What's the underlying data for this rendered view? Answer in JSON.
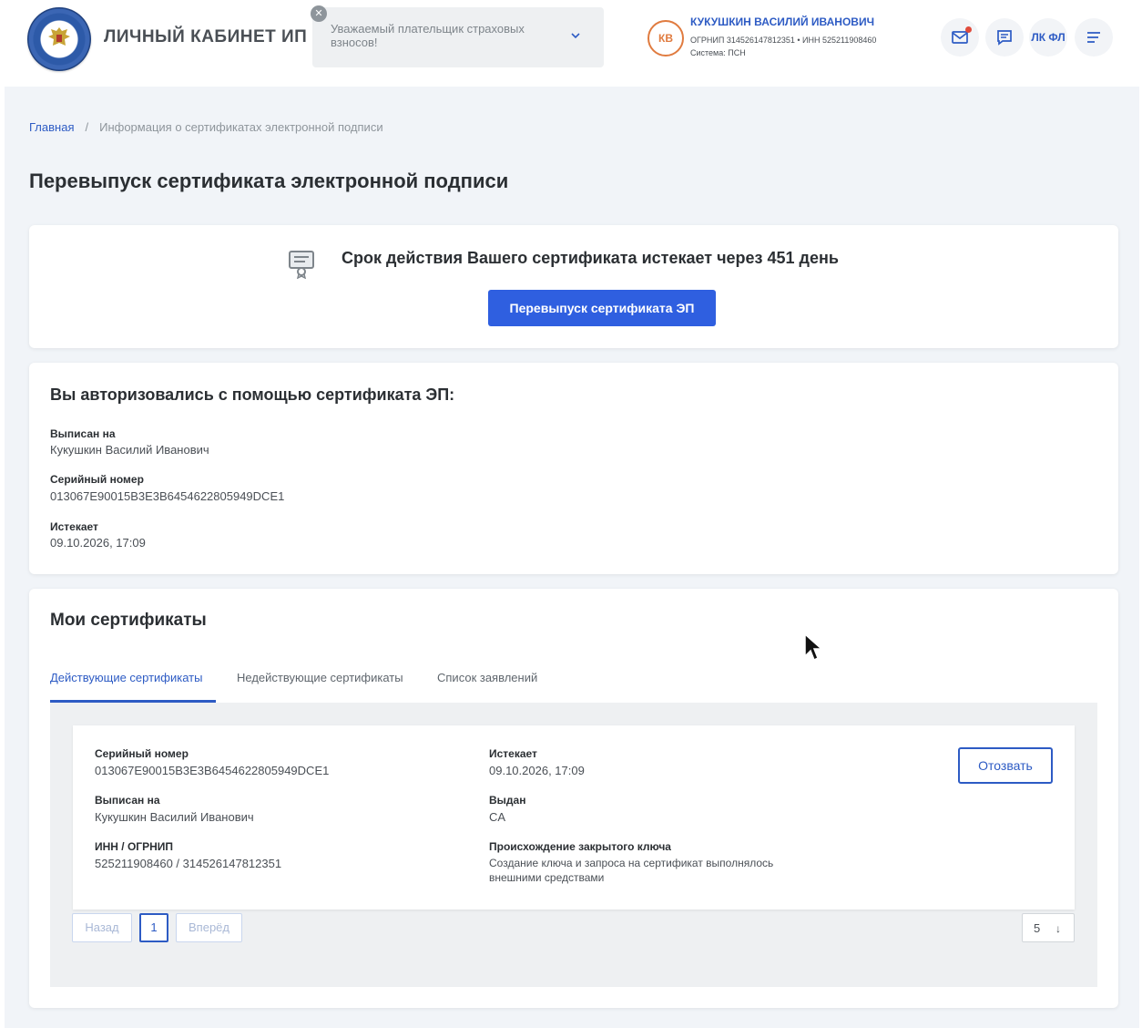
{
  "header": {
    "logo_title": "ЛИЧНЫЙ КАБИНЕТ ИП",
    "notice_text": "Уважаемый плательщик страховых взносов!",
    "notice_badge": "✕",
    "user": {
      "initials": "КВ",
      "name": "КУКУШКИН ВАСИЛИЙ ИВАНОВИЧ",
      "ids": "ОГРНИП 314526147812351  •  ИНН 525211908460",
      "system": "Система: ПСН"
    },
    "icons": [
      "mail-icon",
      "chat-icon",
      "lk-fl-button",
      "menu-icon"
    ],
    "lk_label": "ЛК ФЛ"
  },
  "breadcrumb": {
    "home": "Главная",
    "separator": "/",
    "current": "Информация о сертификатах электронной подписи"
  },
  "page_title": "Перевыпуск сертификата электронной подписи",
  "expiry_card": {
    "message": "Срок действия Вашего сертификата истекает через 451 день",
    "button": "Перевыпуск сертификата ЭП"
  },
  "auth_card": {
    "title": "Вы авторизовались с помощью сертификата ЭП:",
    "fields": [
      {
        "label": "Выписан на",
        "value": "Кукушкин Василий Иванович"
      },
      {
        "label": "Серийный номер",
        "value": "013067E90015B3E3B6454622805949DCE1"
      },
      {
        "label": "Истекает",
        "value": "09.10.2026, 17:09"
      }
    ]
  },
  "my_certs": {
    "title": "Мои сертификаты",
    "tabs": [
      {
        "label": "Действующие сертификаты",
        "active": true
      },
      {
        "label": "Недействующие сертификаты",
        "active": false
      },
      {
        "label": "Список заявлений",
        "active": false
      }
    ],
    "item": {
      "left": [
        {
          "label": "Серийный номер",
          "value": "013067E90015B3E3B6454622805949DCE1"
        },
        {
          "label": "Выписан на",
          "value": "Кукушкин Василий Иванович"
        },
        {
          "label": "ИНН / ОГРНИП",
          "value": "525211908460 / 314526147812351"
        }
      ],
      "right": [
        {
          "label": "Истекает",
          "value": "09.10.2026, 17:09"
        },
        {
          "label": "Выдан",
          "value": "CA"
        },
        {
          "label": "Происхождение закрытого ключа",
          "value_line1": "Создание ключа и запроса на сертификат выполнялось",
          "value_line2": "внешними средствами"
        }
      ],
      "revoke_button": "Отозвать"
    },
    "pagination": {
      "prev": "Назад",
      "current": "1",
      "next": "Вперёд"
    },
    "page_size": "5",
    "page_size_arrow": "↓"
  }
}
